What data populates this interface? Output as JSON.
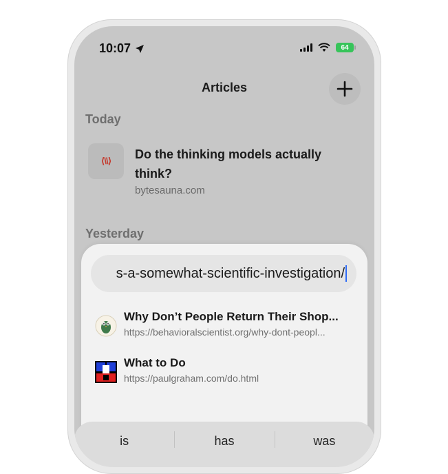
{
  "status_bar": {
    "time": "10:07",
    "location_icon": "location-arrow-icon",
    "wifi_icon": "wifi-icon",
    "battery_level": "64",
    "battery_color": "#37c45a"
  },
  "header": {
    "title": "Articles",
    "add_icon": "plus-icon"
  },
  "sections": {
    "today": "Today",
    "yesterday": "Yesterday"
  },
  "articles": [
    {
      "title": "Do the thinking models actually think?",
      "domain": "bytesauna.com",
      "thumbnail_text": "⟨\\\\⟩"
    }
  ],
  "url_input": {
    "value": "s-a-somewhat-scientific-investigation/"
  },
  "suggestions": [
    {
      "title": "Why Don’t People Return Their Shop...",
      "url": "https://behavioralscientist.org/why-dont-peopl...",
      "icon": "owl-icon"
    },
    {
      "title": "What to Do",
      "url": "https://paulgraham.com/do.html",
      "icon": "paulgraham-logo-icon"
    }
  ],
  "keyboard_suggestions": [
    "is",
    "has",
    "was"
  ]
}
